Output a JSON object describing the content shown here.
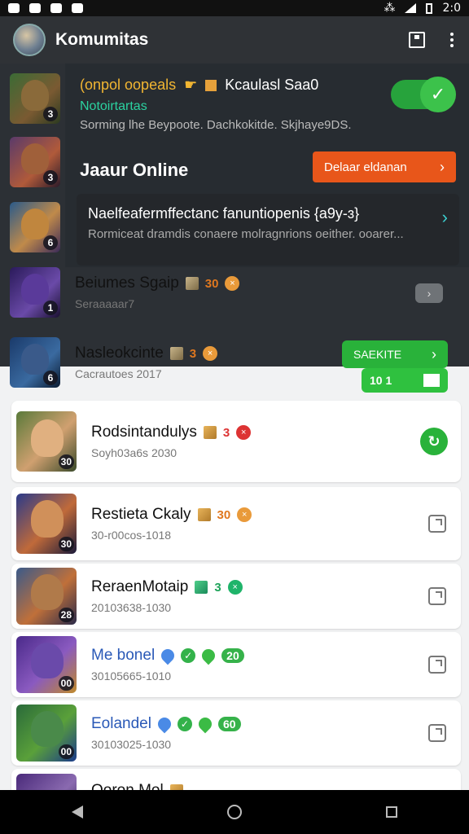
{
  "status_bar": {
    "time": "2:0"
  },
  "app_bar": {
    "title": "Komumitas"
  },
  "overlay": {
    "title_yellow": "(onpol oopeals",
    "title_white": "Kcaulasl Saa0",
    "subtitle_green": "Notoirtartas",
    "description": "Sorming lhe Beypoote. Dachkokitde. Skjhaye9DS.",
    "online_label": "Jaaur Online",
    "action_button": "Delaar eldanan",
    "card_title": "Naelfeafermffectanc fanuntiopenis {a9y-ɜ}",
    "card_text": "Rormiceat dramdis conaere molragnrions oeither. ooarer..."
  },
  "dark_rows": [
    {
      "badge": "3"
    },
    {
      "badge": "3"
    },
    {
      "badge": "6"
    },
    {
      "name": "Beiumes Sgaip",
      "score": "30",
      "subtitle": "Seraaaaar7",
      "badge": "1",
      "button": "›"
    },
    {
      "name": "Nasleokcinte",
      "score": "3",
      "subtitle": "Cacrautoes 2017",
      "badge": "6",
      "button": "SAEKITE",
      "chip": "10 1"
    }
  ],
  "cards": [
    {
      "name": "Rodsintandulys",
      "score": "3",
      "subtitle": "Soyh03a6s 2030",
      "badge": "30",
      "name_color": "normal"
    },
    {
      "name": "Restieta Ckaly",
      "score": "30",
      "subtitle": "30-r00cos-1018",
      "badge": "30"
    },
    {
      "name": "ReraenMotaip",
      "score": "3",
      "subtitle": "20103638-1030",
      "badge": "28"
    },
    {
      "name": "Me bonel",
      "score": "20",
      "subtitle": "30105665-1010",
      "badge": "00"
    },
    {
      "name": "Eolandel",
      "score": "60",
      "subtitle": "30103025-1030",
      "badge": "00"
    },
    {
      "name": "Ooron Mol"
    }
  ]
}
